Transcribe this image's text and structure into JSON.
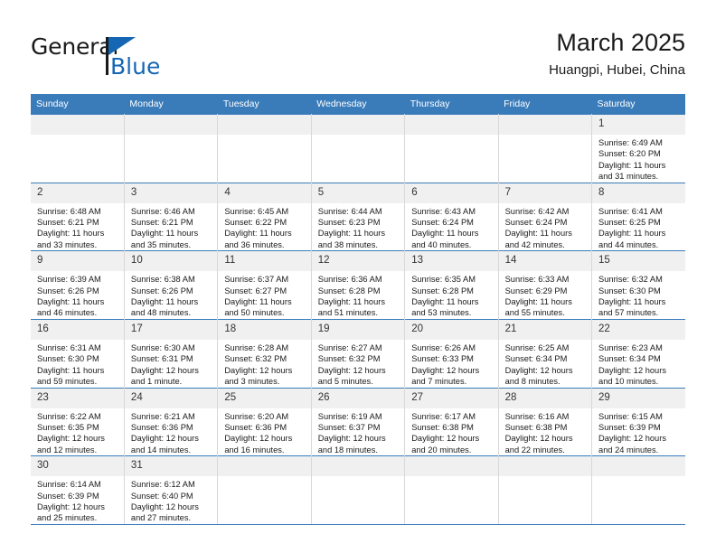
{
  "brand": {
    "name_part1": "General",
    "name_part2": "Blue",
    "triangle_color": "#1567b3"
  },
  "header": {
    "title": "March 2025",
    "subtitle": "Huangpi, Hubei, China",
    "header_bg_color": "#3a7cba"
  },
  "weekdays": [
    "Sunday",
    "Monday",
    "Tuesday",
    "Wednesday",
    "Thursday",
    "Friday",
    "Saturday"
  ],
  "weeks": [
    [
      {
        "day": "",
        "sunrise": "",
        "sunset": "",
        "daylight": ""
      },
      {
        "day": "",
        "sunrise": "",
        "sunset": "",
        "daylight": ""
      },
      {
        "day": "",
        "sunrise": "",
        "sunset": "",
        "daylight": ""
      },
      {
        "day": "",
        "sunrise": "",
        "sunset": "",
        "daylight": ""
      },
      {
        "day": "",
        "sunrise": "",
        "sunset": "",
        "daylight": ""
      },
      {
        "day": "",
        "sunrise": "",
        "sunset": "",
        "daylight": ""
      },
      {
        "day": "1",
        "sunrise": "Sunrise: 6:49 AM",
        "sunset": "Sunset: 6:20 PM",
        "daylight": "Daylight: 11 hours and 31 minutes."
      }
    ],
    [
      {
        "day": "2",
        "sunrise": "Sunrise: 6:48 AM",
        "sunset": "Sunset: 6:21 PM",
        "daylight": "Daylight: 11 hours and 33 minutes."
      },
      {
        "day": "3",
        "sunrise": "Sunrise: 6:46 AM",
        "sunset": "Sunset: 6:21 PM",
        "daylight": "Daylight: 11 hours and 35 minutes."
      },
      {
        "day": "4",
        "sunrise": "Sunrise: 6:45 AM",
        "sunset": "Sunset: 6:22 PM",
        "daylight": "Daylight: 11 hours and 36 minutes."
      },
      {
        "day": "5",
        "sunrise": "Sunrise: 6:44 AM",
        "sunset": "Sunset: 6:23 PM",
        "daylight": "Daylight: 11 hours and 38 minutes."
      },
      {
        "day": "6",
        "sunrise": "Sunrise: 6:43 AM",
        "sunset": "Sunset: 6:24 PM",
        "daylight": "Daylight: 11 hours and 40 minutes."
      },
      {
        "day": "7",
        "sunrise": "Sunrise: 6:42 AM",
        "sunset": "Sunset: 6:24 PM",
        "daylight": "Daylight: 11 hours and 42 minutes."
      },
      {
        "day": "8",
        "sunrise": "Sunrise: 6:41 AM",
        "sunset": "Sunset: 6:25 PM",
        "daylight": "Daylight: 11 hours and 44 minutes."
      }
    ],
    [
      {
        "day": "9",
        "sunrise": "Sunrise: 6:39 AM",
        "sunset": "Sunset: 6:26 PM",
        "daylight": "Daylight: 11 hours and 46 minutes."
      },
      {
        "day": "10",
        "sunrise": "Sunrise: 6:38 AM",
        "sunset": "Sunset: 6:26 PM",
        "daylight": "Daylight: 11 hours and 48 minutes."
      },
      {
        "day": "11",
        "sunrise": "Sunrise: 6:37 AM",
        "sunset": "Sunset: 6:27 PM",
        "daylight": "Daylight: 11 hours and 50 minutes."
      },
      {
        "day": "12",
        "sunrise": "Sunrise: 6:36 AM",
        "sunset": "Sunset: 6:28 PM",
        "daylight": "Daylight: 11 hours and 51 minutes."
      },
      {
        "day": "13",
        "sunrise": "Sunrise: 6:35 AM",
        "sunset": "Sunset: 6:28 PM",
        "daylight": "Daylight: 11 hours and 53 minutes."
      },
      {
        "day": "14",
        "sunrise": "Sunrise: 6:33 AM",
        "sunset": "Sunset: 6:29 PM",
        "daylight": "Daylight: 11 hours and 55 minutes."
      },
      {
        "day": "15",
        "sunrise": "Sunrise: 6:32 AM",
        "sunset": "Sunset: 6:30 PM",
        "daylight": "Daylight: 11 hours and 57 minutes."
      }
    ],
    [
      {
        "day": "16",
        "sunrise": "Sunrise: 6:31 AM",
        "sunset": "Sunset: 6:30 PM",
        "daylight": "Daylight: 11 hours and 59 minutes."
      },
      {
        "day": "17",
        "sunrise": "Sunrise: 6:30 AM",
        "sunset": "Sunset: 6:31 PM",
        "daylight": "Daylight: 12 hours and 1 minute."
      },
      {
        "day": "18",
        "sunrise": "Sunrise: 6:28 AM",
        "sunset": "Sunset: 6:32 PM",
        "daylight": "Daylight: 12 hours and 3 minutes."
      },
      {
        "day": "19",
        "sunrise": "Sunrise: 6:27 AM",
        "sunset": "Sunset: 6:32 PM",
        "daylight": "Daylight: 12 hours and 5 minutes."
      },
      {
        "day": "20",
        "sunrise": "Sunrise: 6:26 AM",
        "sunset": "Sunset: 6:33 PM",
        "daylight": "Daylight: 12 hours and 7 minutes."
      },
      {
        "day": "21",
        "sunrise": "Sunrise: 6:25 AM",
        "sunset": "Sunset: 6:34 PM",
        "daylight": "Daylight: 12 hours and 8 minutes."
      },
      {
        "day": "22",
        "sunrise": "Sunrise: 6:23 AM",
        "sunset": "Sunset: 6:34 PM",
        "daylight": "Daylight: 12 hours and 10 minutes."
      }
    ],
    [
      {
        "day": "23",
        "sunrise": "Sunrise: 6:22 AM",
        "sunset": "Sunset: 6:35 PM",
        "daylight": "Daylight: 12 hours and 12 minutes."
      },
      {
        "day": "24",
        "sunrise": "Sunrise: 6:21 AM",
        "sunset": "Sunset: 6:36 PM",
        "daylight": "Daylight: 12 hours and 14 minutes."
      },
      {
        "day": "25",
        "sunrise": "Sunrise: 6:20 AM",
        "sunset": "Sunset: 6:36 PM",
        "daylight": "Daylight: 12 hours and 16 minutes."
      },
      {
        "day": "26",
        "sunrise": "Sunrise: 6:19 AM",
        "sunset": "Sunset: 6:37 PM",
        "daylight": "Daylight: 12 hours and 18 minutes."
      },
      {
        "day": "27",
        "sunrise": "Sunrise: 6:17 AM",
        "sunset": "Sunset: 6:38 PM",
        "daylight": "Daylight: 12 hours and 20 minutes."
      },
      {
        "day": "28",
        "sunrise": "Sunrise: 6:16 AM",
        "sunset": "Sunset: 6:38 PM",
        "daylight": "Daylight: 12 hours and 22 minutes."
      },
      {
        "day": "29",
        "sunrise": "Sunrise: 6:15 AM",
        "sunset": "Sunset: 6:39 PM",
        "daylight": "Daylight: 12 hours and 24 minutes."
      }
    ],
    [
      {
        "day": "30",
        "sunrise": "Sunrise: 6:14 AM",
        "sunset": "Sunset: 6:39 PM",
        "daylight": "Daylight: 12 hours and 25 minutes."
      },
      {
        "day": "31",
        "sunrise": "Sunrise: 6:12 AM",
        "sunset": "Sunset: 6:40 PM",
        "daylight": "Daylight: 12 hours and 27 minutes."
      },
      {
        "day": "",
        "sunrise": "",
        "sunset": "",
        "daylight": ""
      },
      {
        "day": "",
        "sunrise": "",
        "sunset": "",
        "daylight": ""
      },
      {
        "day": "",
        "sunrise": "",
        "sunset": "",
        "daylight": ""
      },
      {
        "day": "",
        "sunrise": "",
        "sunset": "",
        "daylight": ""
      },
      {
        "day": "",
        "sunrise": "",
        "sunset": "",
        "daylight": ""
      }
    ]
  ]
}
